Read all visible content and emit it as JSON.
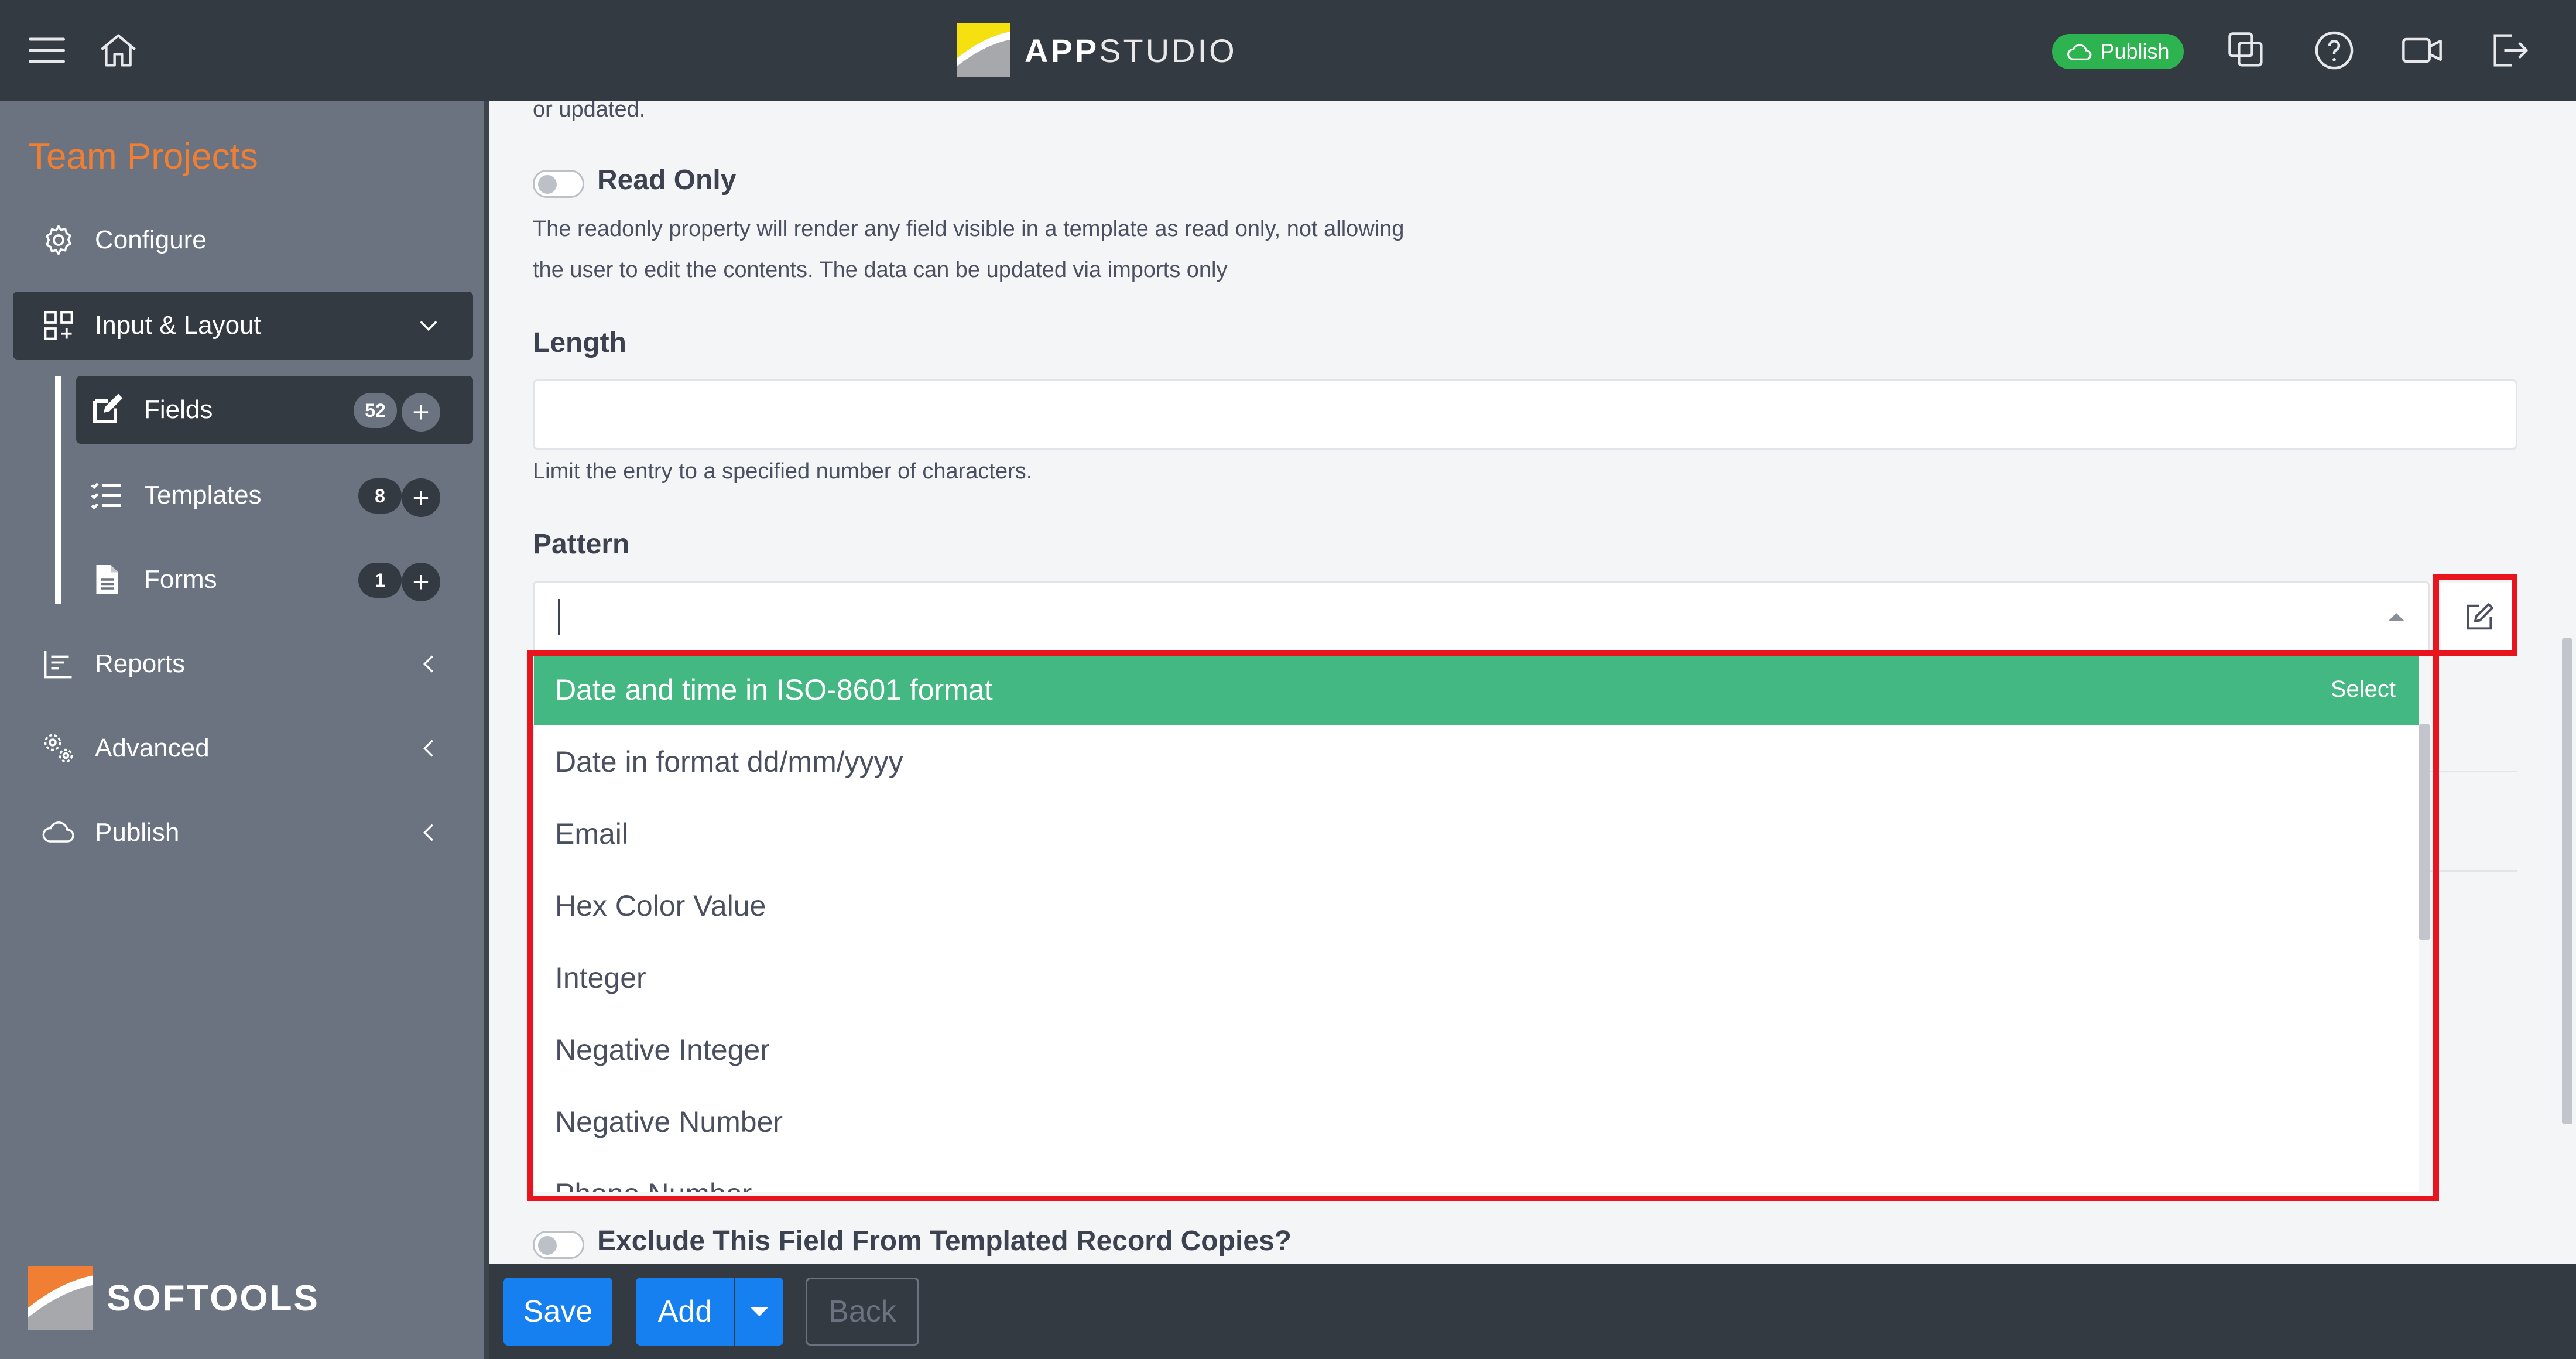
{
  "header": {
    "brand_bold": "APP",
    "brand_light": "STUDIO",
    "publish_label": "Publish",
    "icons": [
      "hamburger-menu-icon",
      "home-icon",
      "copy-icon",
      "help-icon",
      "video-icon",
      "logout-icon"
    ]
  },
  "sidebar": {
    "title": "Team Projects",
    "items": [
      {
        "label": "Configure",
        "icon": "gear-icon"
      },
      {
        "label": "Input & Layout",
        "icon": "layout-icon"
      },
      {
        "label": "Reports",
        "icon": "chart-icon"
      },
      {
        "label": "Advanced",
        "icon": "gears-icon"
      },
      {
        "label": "Publish",
        "icon": "cloud-icon"
      }
    ],
    "subitems": [
      {
        "label": "Fields",
        "count": "52",
        "icon": "edit-icon"
      },
      {
        "label": "Templates",
        "count": "8",
        "icon": "checklist-icon"
      },
      {
        "label": "Forms",
        "count": "1",
        "icon": "document-icon"
      }
    ],
    "footer": "SOFTOOLS"
  },
  "main": {
    "top_fragment": "or updated.",
    "read_only": {
      "label": "Read Only",
      "desc1": "The readonly property will render any field visible in a template as read only, not allowing",
      "desc2": "the user to edit the contents. The data can be updated via imports only"
    },
    "length": {
      "label": "Length",
      "value": "",
      "help": "Limit the entry to a specified number of characters."
    },
    "pattern": {
      "label": "Pattern",
      "value": "",
      "options": [
        "Date and time in ISO-8601 format",
        "Date in format dd/mm/yyyy",
        "Email",
        "Hex Color Value",
        "Integer",
        "Negative Integer",
        "Negative Number",
        "Phone Number"
      ],
      "select_hint": "Select"
    },
    "exclude": {
      "label": "Exclude This Field From Templated Record Copies?"
    }
  },
  "footer": {
    "save": "Save",
    "add": "Add",
    "back": "Back"
  },
  "colors": {
    "topbar": "#343a42",
    "sidebar": "#6b7380",
    "accent_orange": "#f07f33",
    "selected_option": "#43b883",
    "primary_button": "#1680f0",
    "highlight_red": "#e8141e"
  }
}
